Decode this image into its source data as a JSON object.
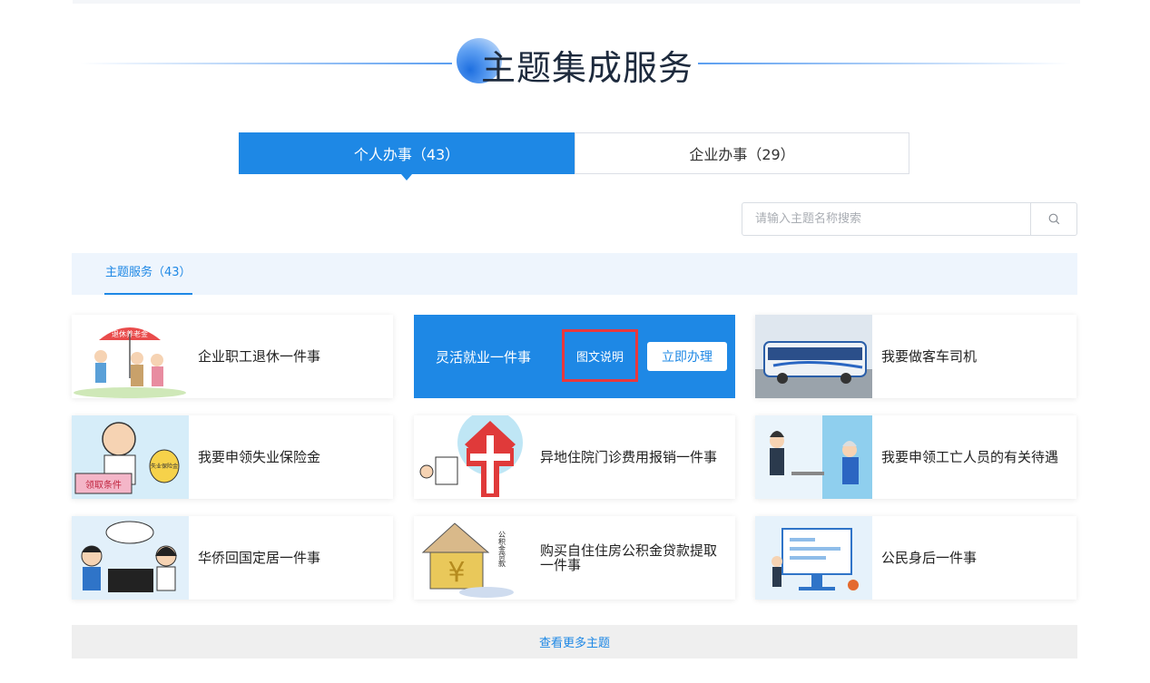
{
  "section_title": "主题集成服务",
  "tabs": [
    {
      "label": "个人办事（43）",
      "active": true
    },
    {
      "label": "企业办事（29）",
      "active": false
    }
  ],
  "search": {
    "placeholder": "请输入主题名称搜索",
    "icon": "search-icon"
  },
  "category": {
    "label": "主题服务（43）"
  },
  "cards": [
    {
      "title": "企业职工退休一件事",
      "thumb_text": "退休养老金"
    },
    {
      "title": "灵活就业一件事",
      "doc_button": "图文说明",
      "go_button": "立即办理",
      "highlighted": true
    },
    {
      "title": "我要做客车司机"
    },
    {
      "title": "我要申领失业保险金",
      "thumb_text": "领取条件",
      "thumb_badge": "失业保险金"
    },
    {
      "title": "异地住院门诊费用报销一件事"
    },
    {
      "title": "我要申领工亡人员的有关待遇"
    },
    {
      "title": "华侨回国定居一件事"
    },
    {
      "title": "购买自住住房公积金贷款提取一件事",
      "thumb_text": "公积金贷款"
    },
    {
      "title": "公民身后一件事"
    }
  ],
  "more": {
    "label": "查看更多主题"
  },
  "colors": {
    "primary": "#1e88e5",
    "highlight_border": "#e8383d"
  }
}
